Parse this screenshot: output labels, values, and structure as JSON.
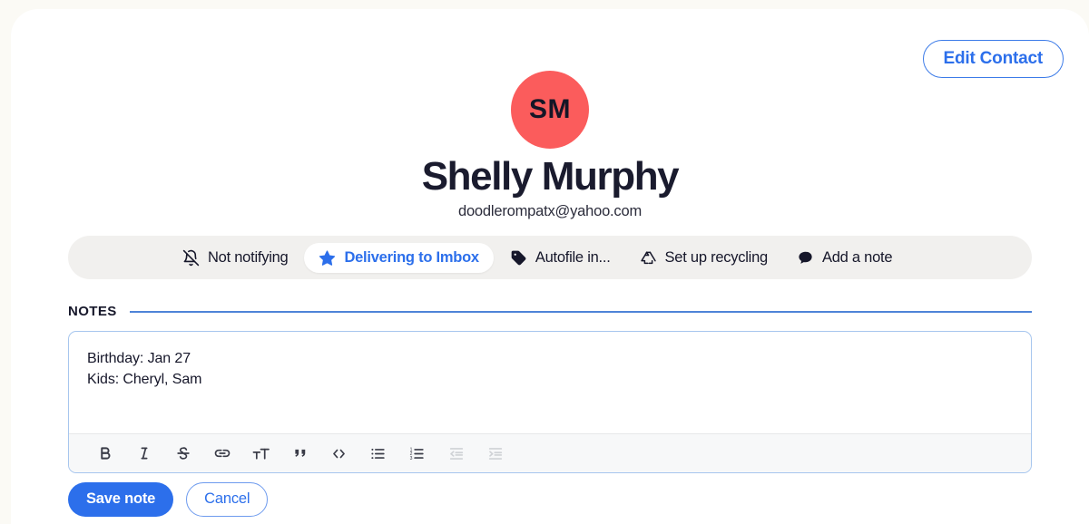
{
  "window": {
    "card_background": "#FFFFFF",
    "page_background": "#FBFAF5"
  },
  "header": {
    "edit_contact_label": "Edit Contact",
    "avatar_initials": "SM",
    "avatar_color": "#FB5C5C",
    "contact_name": "Shelly Murphy",
    "contact_email": "doodlerompatx@yahoo.com"
  },
  "accent": {
    "blue": "#2C6FEB",
    "rule_blue": "#4E84D8",
    "pillbar_background": "#F1F0EE"
  },
  "actions": [
    {
      "icon": "bell-off-icon",
      "label": "Not notifying",
      "active": false
    },
    {
      "icon": "star-icon",
      "label": "Delivering to Imbox",
      "active": true
    },
    {
      "icon": "tag-icon",
      "label": "Autofile in...",
      "active": false
    },
    {
      "icon": "recycle-icon",
      "label": "Set up recycling",
      "active": false
    },
    {
      "icon": "comment-icon",
      "label": "Add a note",
      "active": false
    }
  ],
  "notes": {
    "section_label": "NOTES",
    "lines": [
      "Birthday: Jan 27",
      "Kids: Cheryl, Sam"
    ],
    "toolbar": [
      {
        "icon": "bold-icon",
        "label": "Bold",
        "disabled": false
      },
      {
        "icon": "italic-icon",
        "label": "Italic",
        "disabled": false
      },
      {
        "icon": "strikethrough-icon",
        "label": "Strikethrough",
        "disabled": false
      },
      {
        "icon": "link-icon",
        "label": "Link",
        "disabled": false
      },
      {
        "icon": "heading-icon",
        "label": "Heading",
        "disabled": false
      },
      {
        "icon": "quote-icon",
        "label": "Quote",
        "disabled": false
      },
      {
        "icon": "code-icon",
        "label": "Code",
        "disabled": false
      },
      {
        "icon": "bullet-list-icon",
        "label": "Bulleted list",
        "disabled": false
      },
      {
        "icon": "numbered-list-icon",
        "label": "Numbered list",
        "disabled": false
      },
      {
        "icon": "outdent-icon",
        "label": "Decrease level",
        "disabled": true
      },
      {
        "icon": "indent-icon",
        "label": "Increase level",
        "disabled": true
      }
    ]
  },
  "footer": {
    "save_label": "Save note",
    "cancel_label": "Cancel"
  }
}
